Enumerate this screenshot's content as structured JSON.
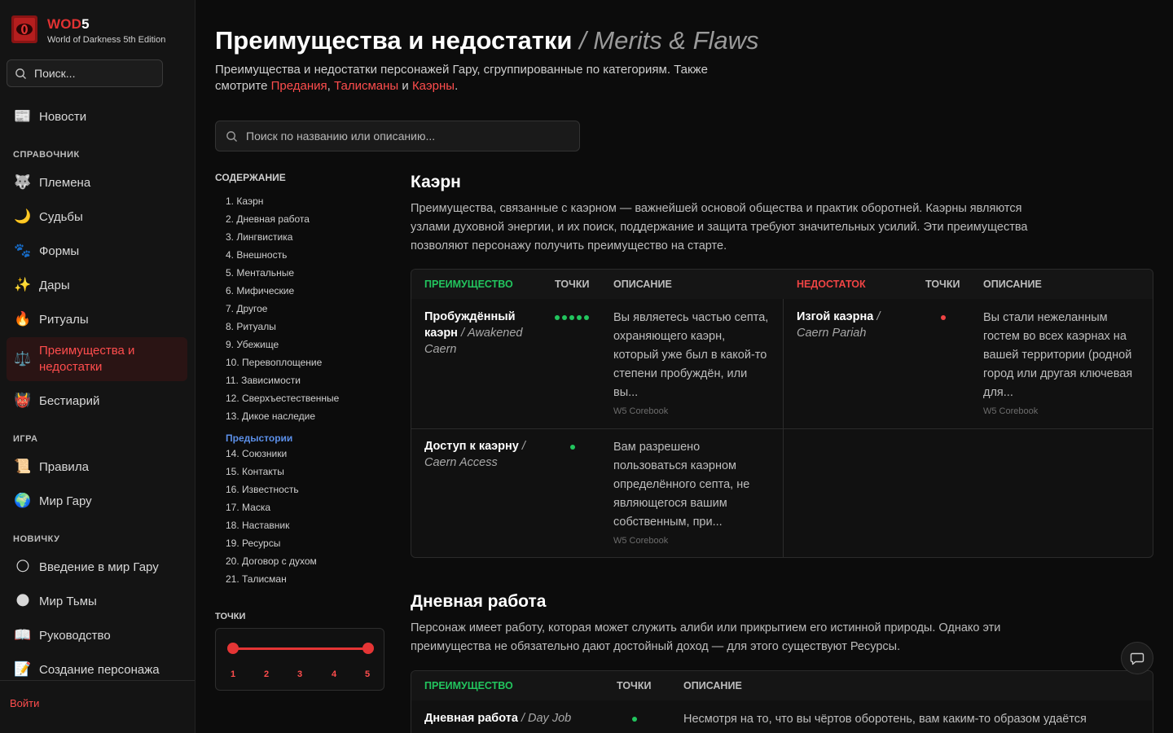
{
  "brand": {
    "name_red": "WOD",
    "name_white": "5",
    "subtitle": "World of Darkness 5th Edition"
  },
  "sidebar": {
    "search_placeholder": "Поиск...",
    "top_items": [
      {
        "emoji": "📰",
        "label": "Новости",
        "icon": "newspaper-icon"
      }
    ],
    "sections": [
      {
        "title": "СПРАВОЧНИК",
        "items": [
          {
            "emoji": "🐺",
            "label": "Племена",
            "icon": "wolf-icon"
          },
          {
            "emoji": "🌙",
            "label": "Судьбы",
            "icon": "moon-icon"
          },
          {
            "emoji": "🐾",
            "label": "Формы",
            "icon": "paw-icon"
          },
          {
            "emoji": "✨",
            "label": "Дары",
            "icon": "sparkles-icon"
          },
          {
            "emoji": "🔥",
            "label": "Ритуалы",
            "icon": "fire-icon"
          },
          {
            "emoji": "⚖️",
            "label": "Преимущества и недостатки",
            "icon": "scales-icon",
            "active": true
          },
          {
            "emoji": "👹",
            "label": "Бестиарий",
            "icon": "monster-icon"
          }
        ]
      },
      {
        "title": "ИГРА",
        "items": [
          {
            "emoji": "📜",
            "label": "Правила",
            "icon": "scroll-icon"
          },
          {
            "emoji": "🌍",
            "label": "Мир Гару",
            "icon": "globe-icon"
          }
        ]
      },
      {
        "title": "НОВИЧКУ",
        "items": [
          {
            "emoji": "🌕",
            "label": "Введение в мир Гару",
            "icon": "full-moon-icon"
          },
          {
            "emoji": "🌑",
            "label": "Мир Тьмы",
            "icon": "dark-moon-icon"
          },
          {
            "emoji": "📖",
            "label": "Руководство",
            "icon": "book-icon"
          },
          {
            "emoji": "📝",
            "label": "Создание персонажа",
            "icon": "memo-icon"
          }
        ]
      }
    ],
    "login": "Войти"
  },
  "page": {
    "title": "Преимущества и недостатки",
    "title_en": "/ Merits & Flaws",
    "intro_text": "Преимущества и недостатки персонажей Гару, сгруппированные по категориям. Также смотрите",
    "intro_links": [
      "Предания",
      "Талисманы",
      "Каэрны"
    ],
    "intro_sep_comma": ",",
    "intro_and": "и",
    "intro_end": ".",
    "search_placeholder": "Поиск по названию или описанию..."
  },
  "toc": {
    "title": "СОДЕРЖАНИЕ",
    "items": [
      "1. Каэрн",
      "2. Дневная работа",
      "3. Лингвистика",
      "4. Внешность",
      "5. Ментальные",
      "6. Мифические",
      "7. Другое",
      "8. Ритуалы",
      "9. Убежище",
      "10. Перевоплощение",
      "11. Зависимости",
      "12. Сверхъестественные",
      "13. Дикое наследие"
    ],
    "subhead": "Предыстории",
    "sub_items": [
      "14. Союзники",
      "15. Контакты",
      "16. Известность",
      "17. Маска",
      "18. Наставник",
      "19. Ресурсы",
      "20. Договор с духом",
      "21. Талисман"
    ]
  },
  "points_filter": {
    "title": "ТОЧКИ",
    "labels": [
      "1",
      "2",
      "3",
      "4",
      "5"
    ],
    "min": 1,
    "max": 5,
    "accent": "#e53535"
  },
  "sections": [
    {
      "title": "Каэрн",
      "desc": "Преимущества, связанные с каэрном — важнейшей основой общества и практик оборотней. Каэрны являются узлами духовной энергии, и их поиск, поддержание и защита требуют значительных усилий. Эти преимущества позволяют персонажу получить преимущество на старте.",
      "headers": {
        "merit": "ПРЕИМУЩЕСТВО",
        "points": "ТОЧКИ",
        "desc": "ОПИСАНИЕ",
        "flaw": "НЕДОСТАТОК",
        "flaw_points": "ТОЧКИ",
        "flaw_desc": "ОПИСАНИЕ"
      },
      "merits": [
        {
          "name": "Пробуждённый каэрн",
          "name_en": "/ Awakened Caern",
          "dots": 5,
          "desc": "Вы являетесь частью септа, охраняющего каэрн, который уже был в какой-то степени пробуждён, или вы...",
          "source": "W5 Corebook"
        },
        {
          "name": "Доступ к каэрну",
          "name_en": "/ Caern Access",
          "dots": 1,
          "desc": "Вам разрешено пользоваться каэрном определённого септа, не являющегося вашим собственным, при...",
          "source": "W5 Corebook"
        }
      ],
      "flaws": [
        {
          "name": "Изгой каэрна",
          "name_en": "/ Caern Pariah",
          "dots": 1,
          "desc": "Вы стали нежеланным гостем во всех каэрнах на вашей территории (родной город или другая ключевая для...",
          "source": "W5 Corebook"
        }
      ]
    },
    {
      "title": "Дневная работа",
      "desc": "Персонаж имеет работу, которая может служить алиби или прикрытием его истинной природы. Однако эти преимущества не обязательно дают достойный доход — для этого существуют Ресурсы.",
      "headers": {
        "merit": "ПРЕИМУЩЕСТВО",
        "points": "ТОЧКИ",
        "desc": "ОПИСАНИЕ"
      },
      "merits": [
        {
          "name": "Дневная работа",
          "name_en": "/ Day Job",
          "dots": 1,
          "desc": "Несмотря на то, что вы чёртов оборотень, вам каким-то образом удаётся"
        }
      ]
    }
  ],
  "colors": {
    "accent_red": "#e03232",
    "merit_green": "#22c55e",
    "flaw_red": "#ef4444",
    "toc_blue": "#5b8fe8"
  }
}
